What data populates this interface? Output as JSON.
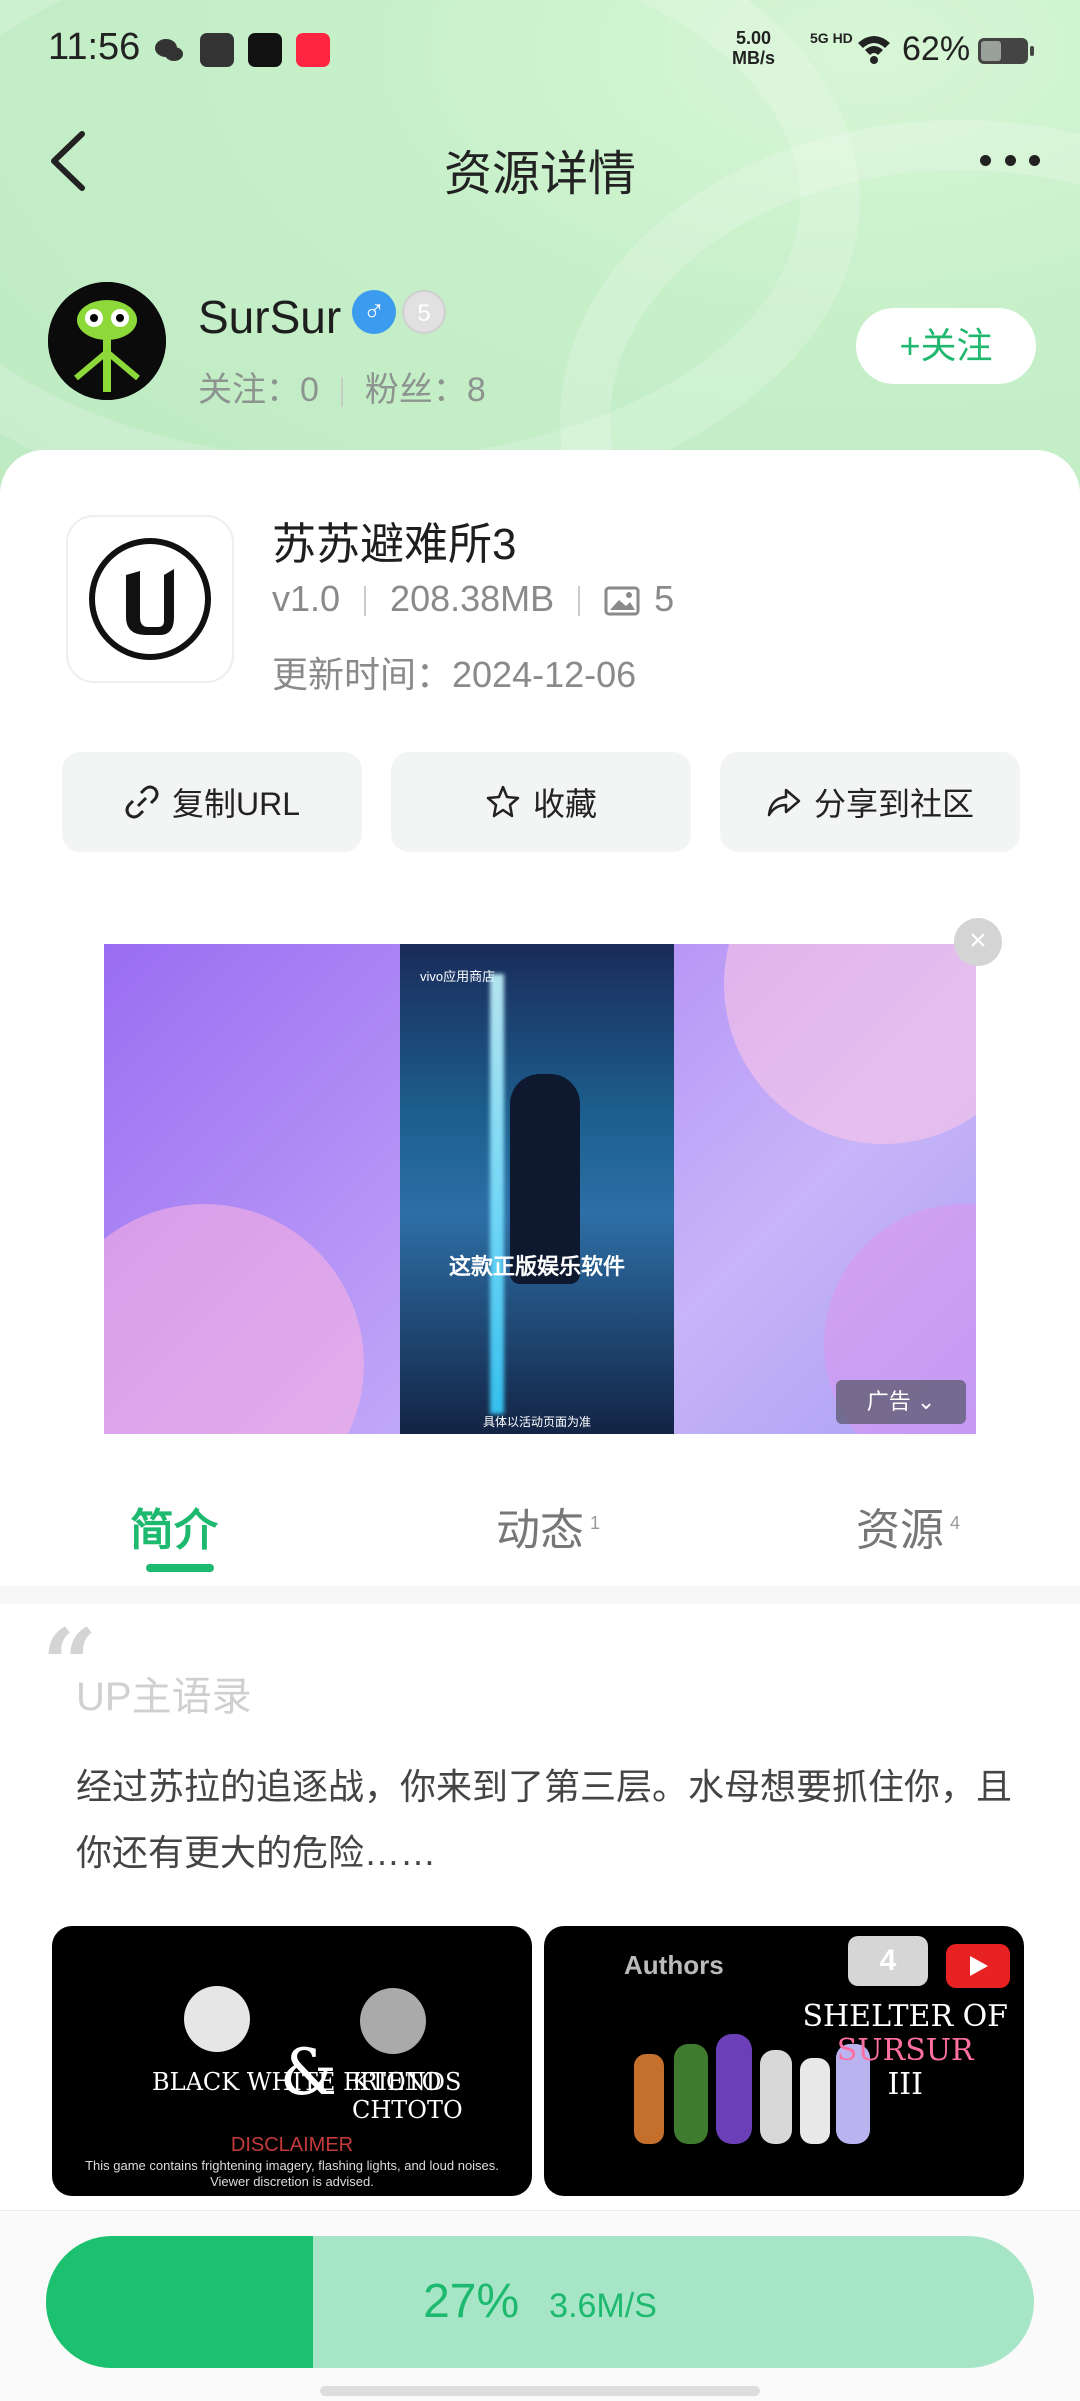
{
  "status_bar": {
    "time": "11:56",
    "net_speed_top": "5.00",
    "net_speed_unit": "MB/s",
    "signal": "5G HD",
    "battery_pct": "62%",
    "app_icons": [
      "wechat-icon",
      "message-icon",
      "capcut-icon",
      "xiaohongshu-icon"
    ]
  },
  "nav": {
    "title": "资源详情",
    "back_icon": "chevron-left-icon",
    "more_icon": "more-icon"
  },
  "author": {
    "name": "SurSur",
    "following_label": "关注：",
    "following": "0",
    "fans_label": "粉丝：",
    "fans": "8",
    "level": "5",
    "gender_icon": "male-icon",
    "follow_button": "+关注"
  },
  "resource": {
    "title": "苏苏避难所3",
    "version": "v1.0",
    "size": "208.38MB",
    "image_count": "5",
    "update_label": "更新时间：",
    "update_date": "2024-12-06"
  },
  "actions": {
    "copy_url": "复制URL",
    "favorite": "收藏",
    "share": "分享到社区"
  },
  "ad": {
    "brand": "vivo应用商店",
    "caption": "这款正版娱乐软件",
    "subcaption": "具体以活动页面为准",
    "tag": "广告"
  },
  "tabs": [
    {
      "label": "简介",
      "count": ""
    },
    {
      "label": "动态",
      "count": "1"
    },
    {
      "label": "资源",
      "count": "4"
    }
  ],
  "intro": {
    "section_title": "UP主语录",
    "quote": "经过苏拉的追逐战，你来到了第三层。水母想要抓住你，且你还有更大的危险……"
  },
  "thumbnails": {
    "t1_left": "BLACK WHITE FRIENDS",
    "t1_amp": "&",
    "t1_right": "KTOTO CHTOTO",
    "t1_disclaimer": "DISCLAIMER",
    "t1_disclaimer_text": "This game contains frightening imagery, flashing lights, and loud noises. Viewer discretion is advised.",
    "t2_authors": "Authors",
    "t2_badge": "4",
    "t2_title_1": "SHELTER OF",
    "t2_title_2": "SURSUR",
    "t2_title_3": "III"
  },
  "download": {
    "percent": "27%",
    "speed": "3.6M/S",
    "progress": 0.27
  },
  "colors": {
    "accent": "#1db96e",
    "progress_bg": "#a6e6c6",
    "progress_fill": "#1cc16f",
    "hero_bg": "#c7f0c9"
  }
}
